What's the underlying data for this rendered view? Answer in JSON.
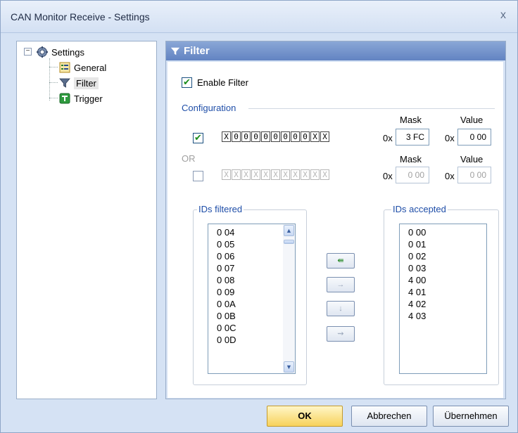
{
  "window": {
    "title": "CAN Monitor Receive - Settings",
    "close_glyph": "x"
  },
  "tree": {
    "root": {
      "label": "Settings",
      "expander": "−",
      "icon": "gear-icon"
    },
    "items": [
      {
        "label": "General",
        "icon": "list-icon",
        "selected": false
      },
      {
        "label": "Filter",
        "icon": "funnel-icon",
        "selected": true
      },
      {
        "label": "Trigger",
        "icon": "trigger-icon",
        "selected": false
      }
    ]
  },
  "panel": {
    "title": "Filter",
    "enable_filter": {
      "label": "Enable Filter",
      "checked": true
    },
    "configuration": {
      "label": "Configuration",
      "or_label": "OR",
      "mask_header": "Mask",
      "value_header": "Value",
      "hex_prefix": "0x",
      "rows": [
        {
          "checked": true,
          "bits": [
            "X",
            "0",
            "0",
            "0",
            "0",
            "0",
            "0",
            "0",
            "0",
            "X",
            "X"
          ],
          "mask": "3 FC",
          "value": "0 00",
          "enabled": true
        },
        {
          "checked": false,
          "bits": [
            "X",
            "X",
            "X",
            "X",
            "X",
            "X",
            "X",
            "X",
            "X",
            "X",
            "X"
          ],
          "mask": "0 00",
          "value": "0 00",
          "enabled": false
        }
      ]
    },
    "ids_filtered": {
      "title": "IDs filtered",
      "items": [
        "0 04",
        "0 05",
        "0 06",
        "0 07",
        "0 08",
        "0 09",
        "0 0A",
        "0 0B",
        "0 0C",
        "0 0D"
      ]
    },
    "ids_accepted": {
      "title": "IDs accepted",
      "items": [
        "0 00",
        "0 01",
        "0 02",
        "0 03",
        "4 00",
        "4 01",
        "4 02",
        "4 03"
      ]
    },
    "move_buttons": [
      {
        "glyph": "⇚",
        "active": true
      },
      {
        "glyph": "→",
        "active": false
      },
      {
        "glyph": "↓",
        "active": false
      },
      {
        "glyph": "⇝",
        "active": false
      }
    ]
  },
  "buttons": {
    "ok": "OK",
    "cancel": "Abbrechen",
    "apply": "Übernehmen"
  },
  "colors": {
    "accent": "#1f4ea8",
    "ok_button": "#f7d25b",
    "check": "#1a8c1a"
  }
}
